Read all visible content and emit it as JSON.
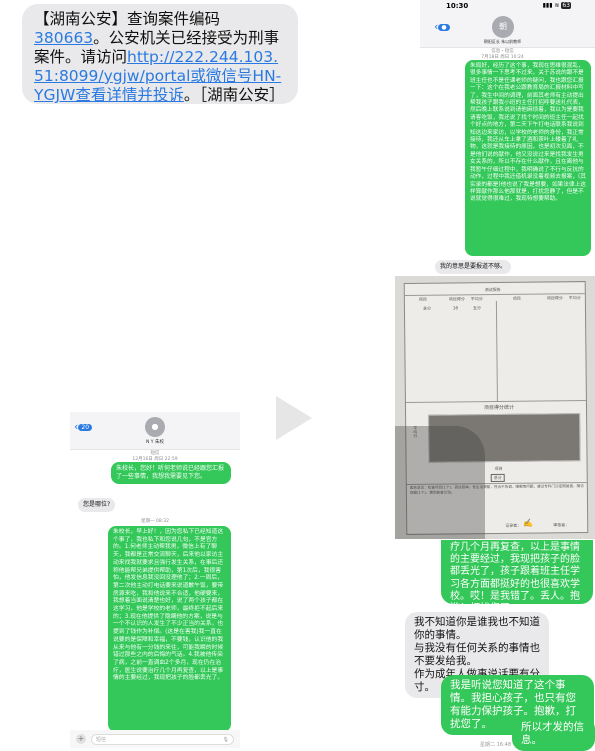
{
  "sms_top": {
    "part1": "【湖南公安】查询案件编码",
    "case_code": "380663",
    "part2": "。公安机关已经接受为刑事案件。请访问",
    "link": "http://222.244.103.51:8099/ygjw/portal或微信号HN-YGJW查看详情并投诉",
    "part3": "。［湖南公安］"
  },
  "left_phone": {
    "back_badge": "20",
    "contact": "N Y 朱校",
    "ts1": "短信\n12月16日 周日 22:59",
    "msg1": "朱校长，您好！听何老师说已经跟您汇报了一些事情，我想我需要见下您。",
    "msg2": "您是哪位?",
    "ts2": "星期一 08:32",
    "msg3": "朱校长，早上好！，因为您私下已经知道这个事了，我也私下和您说几句，不是官方的。1.何老师主动帮我男，微信上有了聊天，我都是正常交流聊天，后来他以家访主动来找我就要求且强行发生关系，在事后还称他能帮兄弟提供帮助，第1次后，我很害怕，他发信息我没回没理他了；2.一周后，第二次他主动打电话要来说道歉午饭，要带房源来吃，我和他说来不合适，他硬要来，我想着当面说清楚也好，说了两个孩子都在这学习，他是学校的老师，最终拒不起后来的；3.现在他提供了隐瞒他的方案，说是与一个不认识的人发生了不少正当的关系，也提到了钱作为补偿。(这是在害我)我一直在说要的是保障和幸福，不要钱，认识他的我从来与他有一分钱的来往，可能我瞬的时候错过那些之内的后悔的气话。4.我被他传染了病，之前一直调血2个多月，现在仍在治疗，医生说要治疗几个月再复查，以上是事情的主要经过，我现把孩子的脸都丢光了。",
    "input_placeholder": "短信"
  },
  "right_phone": {
    "time": "10:30",
    "signal": "signal-wifi-battery",
    "battery": "63",
    "back_badge": "",
    "avatar_initial": "朝",
    "contact": "朝阳区长 朱以前教师",
    "ts1": "信息・短信\n7月18日 周日 10:24",
    "msg1": "朱局好，经历了这个事，我现在思维很混乱，很多事情一下思考不过来，关于苏说的跟不是班主任也不是任课老师的疑问，我也跟您汇报一下：这个在我老公跟教育局的汇报材料中写了，我生中间的调理，前面其老师有主动提出帮我孩子跟我小班的主任打招呼要送礼代表，然后晚上联系说到请他麻烦着，我以为是要我请客吃饭，我还说了找个时间的班主任一起找个好点的地方，第二天下午打电话联系我说到知这边来家访，以学校的老师的身份，我正常接待，我还从车上拿了酒和茶叶上楼着了礼物，这就是我接待的原因，也是初次见面，不是他们说的献作，他又没说过来是找我发生男女关系的，所以不存在什么献作，且在离他与我暂午仔细过程中，我明确说了不行与反抗的动作，过程中我还借机录没着视频去报案，(其实录的都是)他也说了我是想要，如果法律上这样算献作那么他那就是，打扰您静了，但是不说就觉得很难过，我现特想要帮助。",
    "msg2": "我的意思是要报道不够。"
  },
  "document": {
    "header": "测试报告",
    "cols": [
      "项目",
      "项目得分",
      "平均分",
      "项目",
      "项目得分",
      "平均分"
    ],
    "row": [
      "总分",
      "38",
      "五分"
    ],
    "chart_title": "项目得分统计",
    "ylabel": "平均分",
    "xlabel": "项目",
    "legend": "总分",
    "note": "医务意见：检查项目(1个)，表达简单，性生活频繁，性合不协调，睡眠等问题，建议专科门诊定期复查，随访观察(1个)，需到复查诊治。",
    "signer_label": "记录者：",
    "checker_label": "审核者："
  },
  "bottom_right": {
    "msg1": "疗几个月再复查，以上是事情的主要经过，我现把孩子的脸都丢光了，孩子跟着班主任学习各方面都挺好的也很喜欢学校。哎！是我错了。丢人。抱歉！打扰您了。",
    "msg2": "我不知道你是谁我也不知道你的事情。\n与我没有任何关系的事情也不要发给我。\n作为成年人做事说话要有分寸。",
    "msg3": "我是听说您知道了这个事情。我担心孩子，也只有您有能力保护孩子。抱歉，打扰您了。",
    "msg4": "所以才发的信息。",
    "ts": "星期二 16:48"
  },
  "colors": {
    "imessage_green": "#34c759",
    "bubble_gray": "#e9e9eb",
    "link_blue": "#2a7ae2"
  }
}
